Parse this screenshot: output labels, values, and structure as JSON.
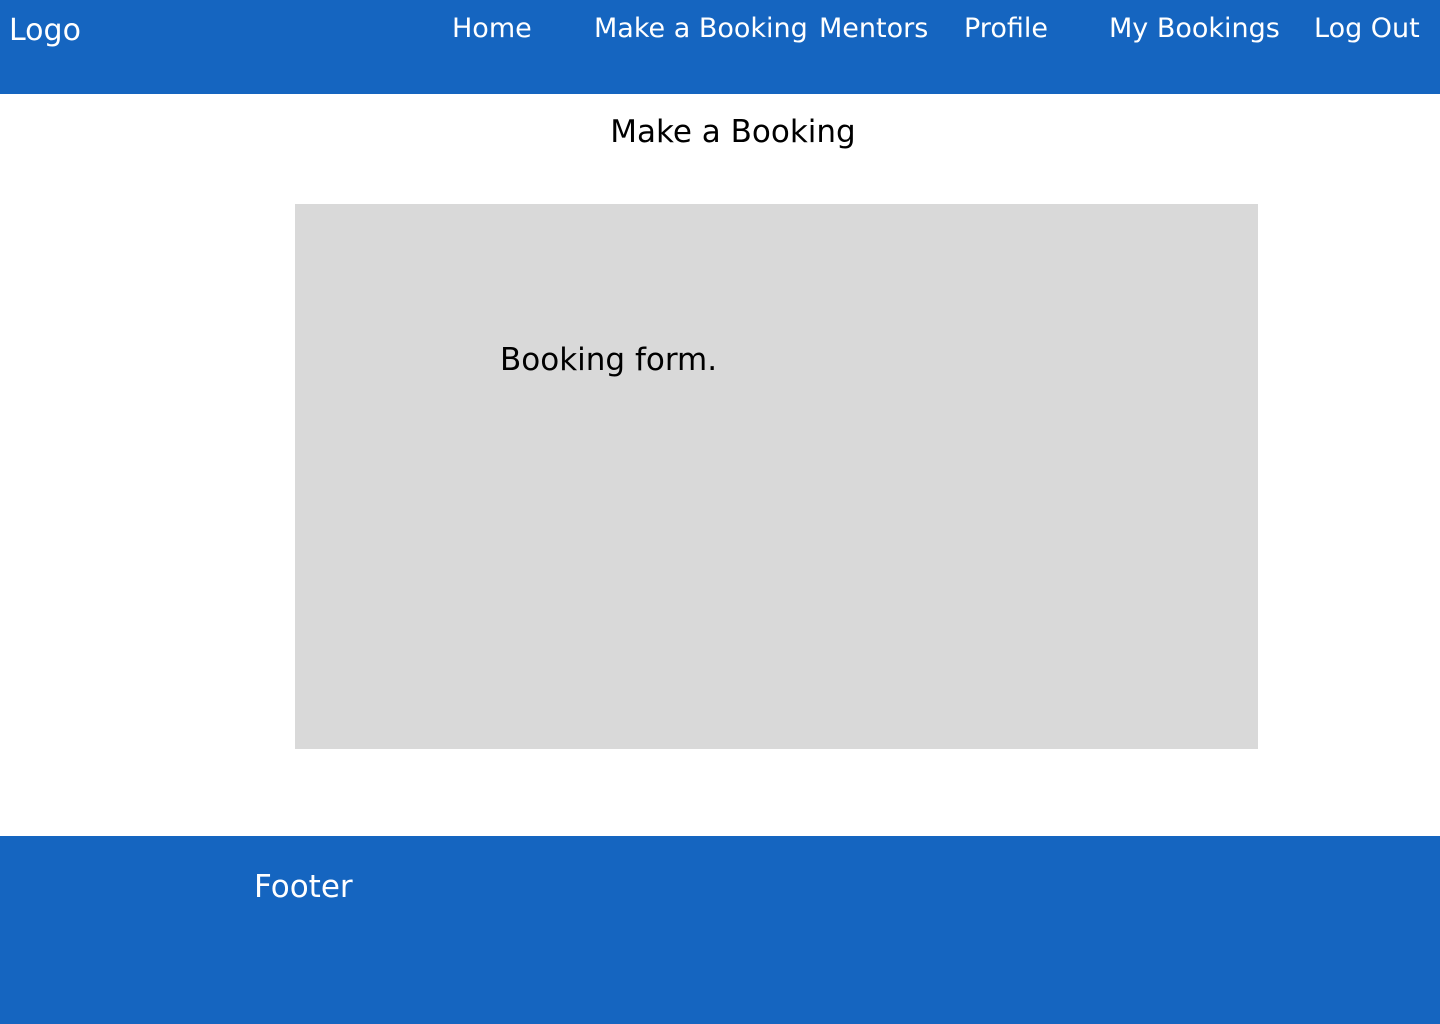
{
  "header": {
    "logo": "Logo",
    "nav": [
      {
        "label": "Home"
      },
      {
        "label": "Make a Booking"
      },
      {
        "label": "Mentors"
      },
      {
        "label": "Profile"
      },
      {
        "label": "My Bookings"
      },
      {
        "label": "Log Out"
      }
    ]
  },
  "main": {
    "title": "Make a Booking",
    "booking_form_placeholder": "Booking form."
  },
  "footer": {
    "label": "Footer"
  },
  "colors": {
    "header_bg": "#1565c0",
    "footer_bg": "#1565c0",
    "form_bg": "#d9d9d9",
    "page_bg": "#ffffff"
  }
}
